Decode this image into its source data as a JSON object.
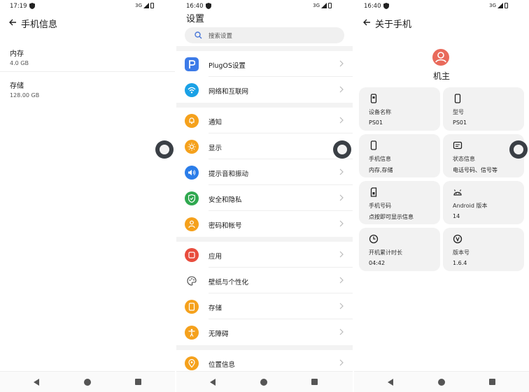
{
  "screen1": {
    "status_time": "17:19",
    "network": "3G",
    "title": "手机信息",
    "items": [
      {
        "label": "内存",
        "value": "4.0 GB"
      },
      {
        "label": "存储",
        "value": "128.00 GB"
      }
    ]
  },
  "screen2": {
    "status_time": "16:40",
    "network": "3G",
    "title": "设置",
    "search_placeholder": "搜索设置",
    "items": [
      {
        "label": "PlugOS设置",
        "icon": "plugos-icon",
        "color": "#3d7be8"
      },
      {
        "label": "网络和互联网",
        "icon": "wifi-icon",
        "color": "#1aa1e6"
      },
      {
        "label": "通知",
        "icon": "notification-icon",
        "color": "#f5a11c"
      },
      {
        "label": "显示",
        "icon": "brightness-icon",
        "color": "#f5a11c"
      },
      {
        "label": "提示音和振动",
        "icon": "volume-icon",
        "color": "#2b7de9"
      },
      {
        "label": "安全和隐私",
        "icon": "shield-icon",
        "color": "#2fa84f"
      },
      {
        "label": "密码和帐号",
        "icon": "account-icon",
        "color": "#f5a11c"
      },
      {
        "label": "应用",
        "icon": "apps-icon",
        "color": "#e84c3d"
      },
      {
        "label": "壁纸与个性化",
        "icon": "palette-icon",
        "color": "#555555"
      },
      {
        "label": "存储",
        "icon": "storage-icon",
        "color": "#f5a11c"
      },
      {
        "label": "无障碍",
        "icon": "accessibility-icon",
        "color": "#f5a11c"
      },
      {
        "label": "位置信息",
        "icon": "location-icon",
        "color": "#f5a11c"
      }
    ]
  },
  "screen3": {
    "status_time": "16:40",
    "network": "3G",
    "title": "关于手机",
    "owner": "机主",
    "avatar_color": "#e96a5b",
    "cards": [
      {
        "label": "设备名称",
        "value": "PS01",
        "icon": "sim-icon"
      },
      {
        "label": "型号",
        "value": "PS01",
        "icon": "phone-icon"
      },
      {
        "label": "手机信息",
        "value": "内存,存储",
        "icon": "phone-icon"
      },
      {
        "label": "状态信息",
        "value": "电话号码、信号等",
        "icon": "card-icon"
      },
      {
        "label": "手机号码",
        "value": "点按即可显示信息",
        "icon": "sim-card-icon"
      },
      {
        "label": "Android 版本",
        "value": "14",
        "icon": "android-icon"
      },
      {
        "label": "开机累计时长",
        "value": "04:42",
        "icon": "clock-icon"
      },
      {
        "label": "版本号",
        "value": "1.6.4",
        "icon": "version-icon"
      }
    ]
  }
}
